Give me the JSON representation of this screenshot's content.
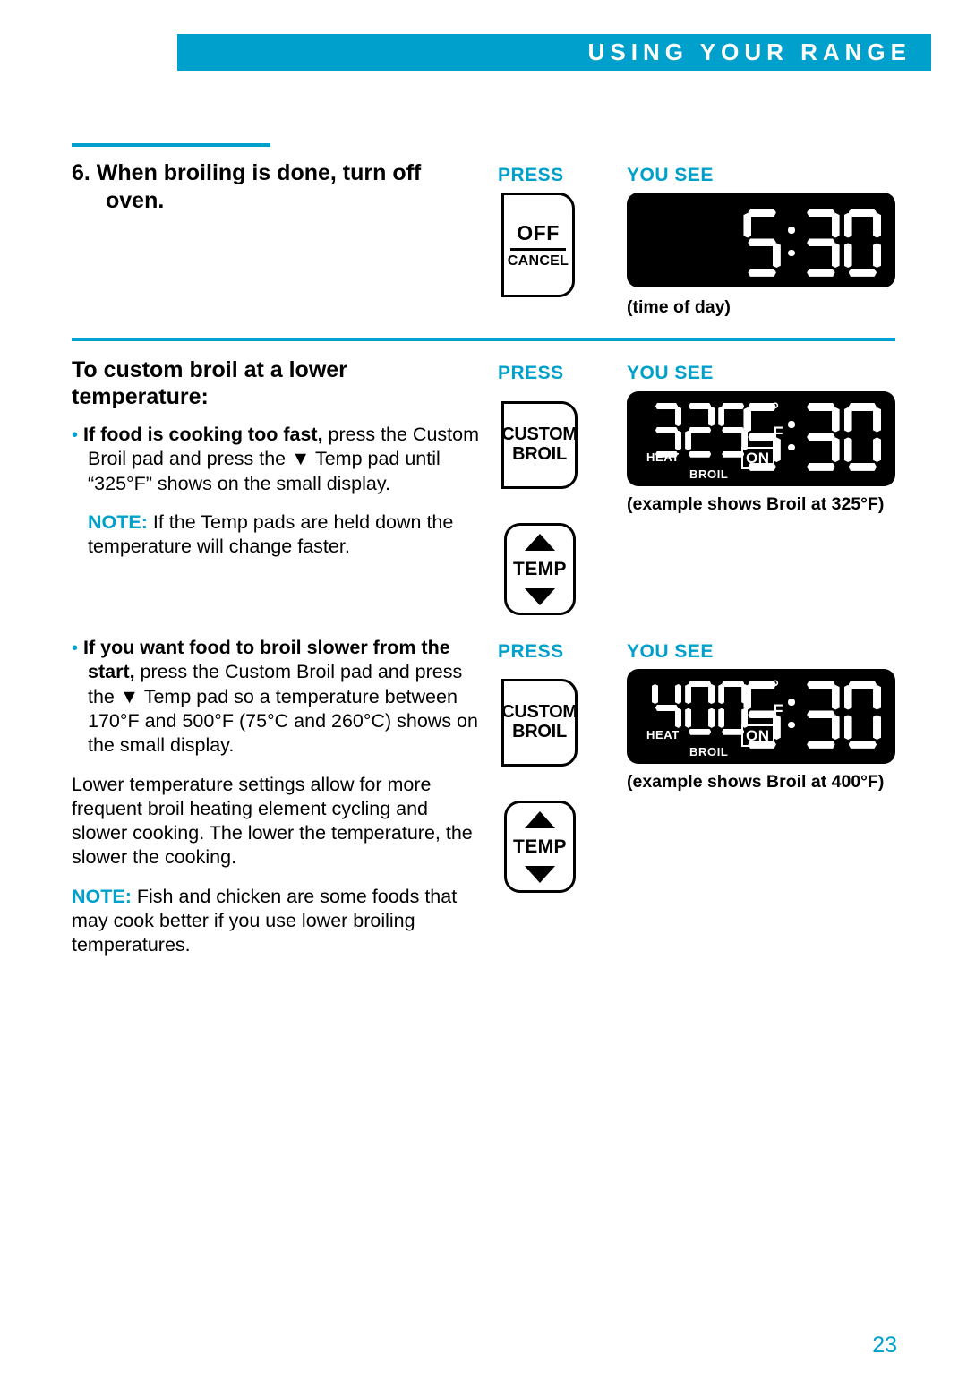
{
  "header": {
    "title": "USING YOUR RANGE"
  },
  "labels": {
    "press": "PRESS",
    "you_see": "YOU SEE"
  },
  "sections": [
    {
      "id": "step6",
      "heading": "6. When broiling is done, turn off oven.",
      "pads": [
        {
          "type": "off-cancel",
          "line1": "OFF",
          "line2": "CANCEL"
        }
      ],
      "display": {
        "time": "5:30",
        "caption": "(time of day)"
      }
    },
    {
      "id": "custom-broil-lower",
      "heading": "To custom broil at a lower temperature:",
      "bullet1": {
        "bold": "If food is cooking too fast,",
        "rest": " press the Custom Broil pad and press the ▼ Temp pad until “325°F” shows on the small display."
      },
      "note1": {
        "label": "NOTE:",
        "text": " If the Temp pads are held down the temperature will change faster."
      },
      "pads": [
        {
          "type": "custom-broil",
          "line1": "CUSTOM",
          "line2": "BROIL"
        },
        {
          "type": "temp",
          "label": "TEMP"
        }
      ],
      "display": {
        "temperature": "325",
        "degree": "°",
        "unit": "F",
        "time": "5:30",
        "heat": "HEAT",
        "on": "ON",
        "broil": "BROIL",
        "caption": "(example shows Broil at 325°F)"
      }
    },
    {
      "id": "broil-slower",
      "bullet2": {
        "bold": "If you want food to broil slower from the start,",
        "rest": " press the Custom Broil pad and press the ▼ Temp pad so a temperature between 170°F and 500°F (75°C and 260°C) shows on the small display."
      },
      "para": "Lower temperature settings allow for more frequent broil heating element cycling and slower cooking. The lower the temperature, the slower the cooking.",
      "note2": {
        "label": "NOTE:",
        "text": " Fish and chicken are some foods that may cook better if you use lower broiling temperatures."
      },
      "pads": [
        {
          "type": "custom-broil",
          "line1": "CUSTOM",
          "line2": "BROIL"
        },
        {
          "type": "temp",
          "label": "TEMP"
        }
      ],
      "display": {
        "temperature": "400",
        "degree": "°",
        "unit": "F",
        "time": "5:30",
        "heat": "HEAT",
        "on": "ON",
        "broil": "BROIL",
        "caption": "(example shows Broil at 400°F)"
      }
    }
  ],
  "footer": {
    "page_number": "23"
  },
  "colors": {
    "accent": "#00a0cc",
    "text": "#000000",
    "lcd_background": "#000000",
    "lcd_foreground": "#ffffff"
  }
}
